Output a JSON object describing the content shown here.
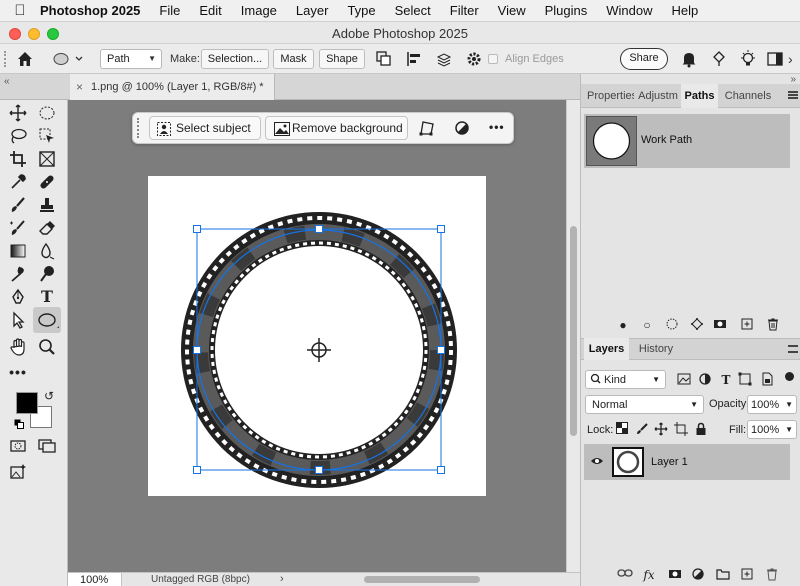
{
  "menubar": {
    "app_name": "Photoshop 2025",
    "items": [
      "File",
      "Edit",
      "Image",
      "Layer",
      "Type",
      "Select",
      "Filter",
      "View",
      "Plugins",
      "Window",
      "Help"
    ]
  },
  "window": {
    "title": "Adobe Photoshop 2025"
  },
  "options": {
    "mode_value": "Path",
    "make_label": "Make:",
    "selection_button": "Selection...",
    "mask_button": "Mask",
    "shape_button": "Shape",
    "align_edges_label": "Align Edges",
    "share_button": "Share"
  },
  "document": {
    "tab_label": "1.png @ 100% (Layer 1, RGB/8#) *"
  },
  "contextual_bar": {
    "select_subject": "Select subject",
    "remove_background": "Remove background",
    "more": "•••"
  },
  "status": {
    "zoom": "100%",
    "profile": "Untagged RGB (8bpc)"
  },
  "paths_panel": {
    "tabs": [
      "Properties",
      "Adjustm",
      "Paths",
      "Channels"
    ],
    "active_tab": "Paths",
    "items": [
      {
        "name": "Work Path"
      }
    ]
  },
  "layers_panel": {
    "tabs": [
      "Layers",
      "History"
    ],
    "active_tab": "Layers",
    "filter_value": "Kind",
    "blend_mode": "Normal",
    "opacity_label": "Opacity:",
    "opacity_value": "100%",
    "lock_label": "Lock:",
    "fill_label": "Fill:",
    "fill_value": "100%",
    "layers": [
      {
        "name": "Layer 1"
      }
    ]
  },
  "colors": {
    "foreground": "#000000",
    "background": "#ffffff",
    "accent": "#1473e6"
  }
}
